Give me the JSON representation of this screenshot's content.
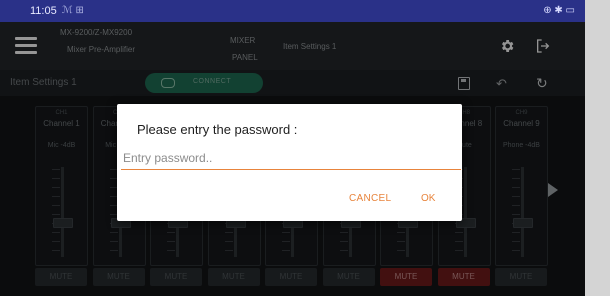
{
  "status_bar": {
    "time": "11:05",
    "notification_icons": "ℳ ⊞",
    "right_icons": "⊕ ✱ ▭"
  },
  "header": {
    "model_line1": "MX-9200/Z-MX9200",
    "model_line2": "Mixer Pre-Amplifier",
    "mixer_label_line1": "MIXER",
    "mixer_label_line2": "PANEL",
    "current_page": "Item Settings 1"
  },
  "toolbar": {
    "title": "Item Settings 1",
    "connect_label": "CONNECT",
    "connected": true
  },
  "channels": [
    {
      "num": "CH1",
      "name": "Channel 1",
      "mode": "Mic -4dB",
      "mute_label": "MUTE",
      "muted": false,
      "fader_level": 0.3
    },
    {
      "num": "CH2",
      "name": "Channel 2",
      "mode": "Mic -4dB",
      "mute_label": "MUTE",
      "muted": false,
      "fader_level": 0.3
    },
    {
      "num": "CH3",
      "name": "",
      "mode": "",
      "mute_label": "MUTE",
      "muted": false,
      "fader_level": 0.3
    },
    {
      "num": "CH4",
      "name": "",
      "mode": "",
      "mute_label": "MUTE",
      "muted": false,
      "fader_level": 0.3
    },
    {
      "num": "CH5",
      "name": "",
      "mode": "",
      "mute_label": "MUTE",
      "muted": false,
      "fader_level": 0.3
    },
    {
      "num": "CH6",
      "name": "",
      "mode": "",
      "mute_label": "MUTE",
      "muted": false,
      "fader_level": 0.3
    },
    {
      "num": "CH7",
      "name": "",
      "mode": "",
      "mute_label": "MUTE",
      "muted": true,
      "fader_level": 0.3
    },
    {
      "num": "CH8",
      "name": "Channel 8",
      "mode": "Mute",
      "mute_label": "MUTE",
      "muted": true,
      "fader_level": 0.3
    },
    {
      "num": "CH9",
      "name": "Channel 9",
      "mode": "Phone -4dB",
      "mute_label": "MUTE",
      "muted": false,
      "fader_level": 0.3
    }
  ],
  "dialog": {
    "title": "Please entry the password :",
    "input_placeholder": "Entry password..",
    "input_value": "",
    "cancel_label": "CANCEL",
    "ok_label": "OK"
  },
  "colors": {
    "accent": "#e8843c",
    "status_bar": "#2a3188",
    "connect": "#1e6a52",
    "muted": "#6b1a1a"
  }
}
